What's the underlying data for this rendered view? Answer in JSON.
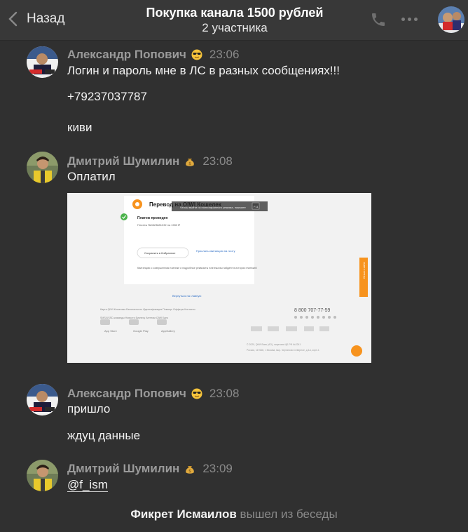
{
  "header": {
    "back_label": "Назад",
    "title": "Покупка канала 1500 рублей",
    "subtitle": "2 участника",
    "icons": [
      "phone-icon",
      "more-icon"
    ]
  },
  "messages": [
    {
      "author": "Александр Попович",
      "status_emoji": "sunglasses-emoji",
      "time": "23:06",
      "lines": [
        "Логин и пароль мне в ЛС в разных сообщениях!!!",
        "+79237037787",
        "киви"
      ]
    },
    {
      "author": "Дмитрий Шумилин",
      "status_emoji": "money-bag-emoji",
      "time": "23:08",
      "lines": [
        "Оплатил"
      ]
    },
    {
      "author": "Александр Попович",
      "status_emoji": "sunglasses-emoji",
      "time": "23:08",
      "lines": [
        "пришло",
        "ждуц данные"
      ]
    },
    {
      "author": "Дмитрий Шумилин",
      "status_emoji": "money-bag-emoji",
      "time": "23:09",
      "lines": [
        "@f_ism"
      ]
    }
  ],
  "attachment": {
    "heading": "Перевод на QIWI Кошелек",
    "tooltip": "Чтобы выйти из полноэкранного режима, нажмите",
    "tooltip_key": "F11",
    "status": "Платеж проведен",
    "details": "Платеж №0823881332 на 1550 ₽",
    "save_button": "Сохранить в Избранное",
    "send_receipt": "Прислать квитанцию на почту",
    "note": "Квитанцию о совершенном платеже и подробные реквизиты платежа вы найдете в истории платежей",
    "back_link": "Вернуться на главную",
    "footer_links": [
      "Карта QIWI Кошелька",
      "Безопасность",
      "Идентификация",
      "Помощь",
      "Офферы",
      "Контакты"
    ],
    "footer_links_2": [
      "SMS/USSD-команды",
      "Новости",
      "Бизнесу",
      "Агентам",
      "QIWI Банк"
    ],
    "phone": "8 800 707-77-59",
    "stores": [
      "App Store",
      "Google Play",
      "AppGallery"
    ],
    "side_tab": "Отзыв о сайте",
    "copyright": "© 2020, QIWI Банк (АО), лицензия ЦБ РФ №2241",
    "address": "Россия, 117648, г. Москва, мкр. Чертаново Северное, д.1А, корп.1"
  },
  "system_event": {
    "name": "Фикрет Исмаилов",
    "action": "вышел из беседы"
  },
  "colors": {
    "background": "#303030",
    "header": "#383838",
    "qiwi_orange": "#f7931e",
    "success_green": "#4bb34b"
  }
}
